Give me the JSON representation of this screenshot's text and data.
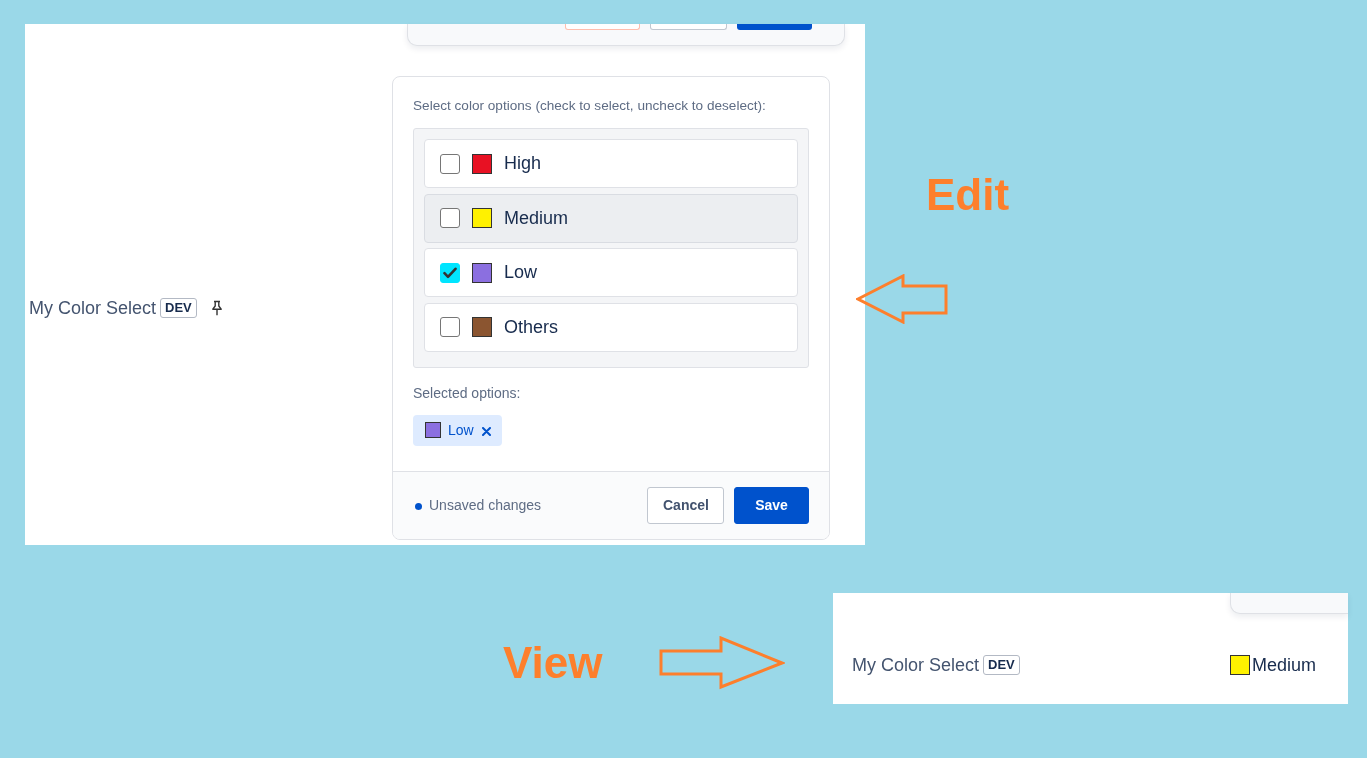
{
  "edit_mode": {
    "top_card": {
      "buttons": [
        {
          "kind": "danger"
        },
        {
          "kind": "secondary"
        },
        {
          "kind": "primary"
        }
      ]
    },
    "field": {
      "label": "My Color Select",
      "badge": "DEV"
    },
    "editor": {
      "instruction": "Select color options (check to select, uncheck to deselect):",
      "options": [
        {
          "label": "High",
          "color": "#e81123",
          "checked": false,
          "highlighted": false
        },
        {
          "label": "Medium",
          "color": "#fff100",
          "checked": false,
          "highlighted": true
        },
        {
          "label": "Low",
          "color": "#8b6fe0",
          "checked": true,
          "highlighted": false
        },
        {
          "label": "Others",
          "color": "#8b5530",
          "checked": false,
          "highlighted": false
        }
      ],
      "selected_heading": "Selected options:",
      "selected_tags": [
        {
          "label": "Low",
          "color": "#8b6fe0"
        }
      ],
      "status": "Unsaved changes",
      "buttons": [
        {
          "label": "Cancel",
          "kind": "secondary"
        },
        {
          "label": "Save",
          "kind": "primary"
        }
      ]
    },
    "caption": "Edit"
  },
  "view_mode": {
    "caption": "View",
    "field": {
      "label": "My Color Select",
      "badge": "DEV",
      "value": {
        "label": "Medium",
        "color": "#fff200"
      }
    }
  }
}
